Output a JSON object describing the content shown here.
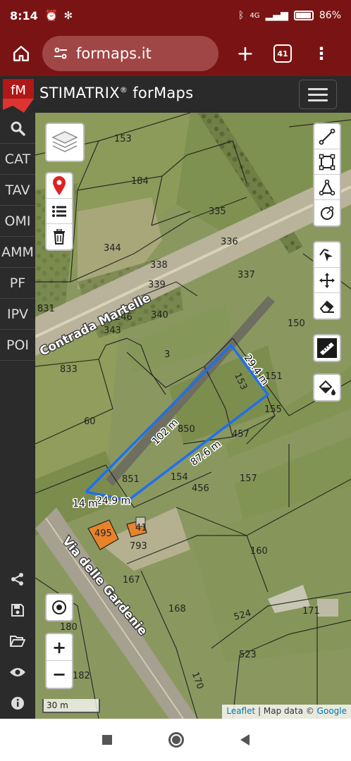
{
  "status_bar": {
    "time": "8:14",
    "network": "4G",
    "battery": "86%"
  },
  "browser": {
    "url": "formaps.it",
    "tab_count": "41"
  },
  "app": {
    "title": "STIMATRIX",
    "title_reg": "®",
    "title_suffix": " forMaps",
    "logo_text": "fM"
  },
  "sidebar": {
    "items": [
      "CAT",
      "TAV",
      "OMI",
      "AMM",
      "PF",
      "IPV",
      "POI"
    ]
  },
  "map": {
    "parcels": [
      "153",
      "184",
      "335",
      "336",
      "344",
      "338",
      "339",
      "337",
      "246",
      "340",
      "343",
      "831",
      "150",
      "3",
      "151",
      "153",
      "833",
      "155",
      "60",
      "850",
      "457",
      "851",
      "154",
      "456",
      "157",
      "495",
      "41",
      "793",
      "160",
      "167",
      "168",
      "171",
      "180",
      "524",
      "523",
      "182",
      "170"
    ],
    "roads": [
      "Contrada Martelle",
      "Via delle Gardenie"
    ],
    "measurements": [
      "102 m",
      "29.4 m",
      "87.6 m",
      "24.9 m",
      "14 m"
    ],
    "scale_label": "30 m",
    "attribution": {
      "leaflet": "Leaflet",
      "sep": " | Map data © ",
      "google": "Google"
    }
  },
  "colors": {
    "chrome": "#7a1414",
    "measure_line": "#1e6ff0",
    "building": "#e8832a"
  }
}
